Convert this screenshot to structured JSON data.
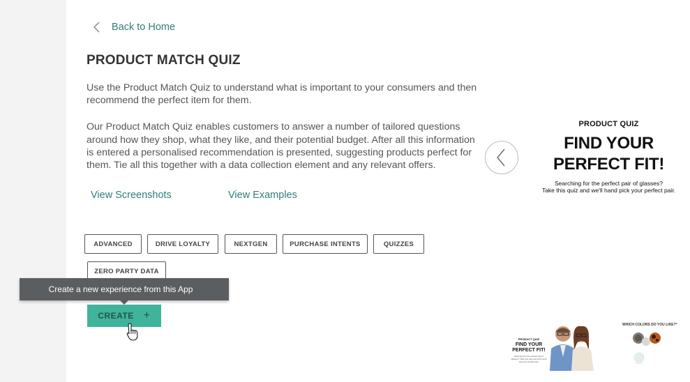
{
  "nav": {
    "back_label": "Back to Home"
  },
  "app": {
    "title": "PRODUCT MATCH QUIZ",
    "description": [
      "Use the Product Match Quiz to understand what is important to your consumers and then recommend the perfect item for them.",
      "Our Product Match Quiz enables customers to answer a number of tailored questions around how they shop, what they like, and their potential budget. After all this information is entered a personalised recommendation is presented, suggesting products perfect for them. Tie all this together with a data collection element and any relevant offers."
    ],
    "links": {
      "screenshots": "View Screenshots",
      "examples": "View Examples"
    },
    "tags": [
      "ADVANCED",
      "DRIVE LOYALTY",
      "NEXTGEN",
      "PURCHASE INTENTS",
      "QUIZZES",
      "ZERO PARTY DATA"
    ],
    "tooltip": "Create a new experience from this App",
    "create_label": "CREATE"
  },
  "preview": {
    "kicker": "PRODUCT QUIZ",
    "headline_1": "FIND YOUR",
    "headline_2": "PERFECT FIT!",
    "sub_1": "Searching for the perfect pair of glasses?",
    "sub_2": "Take this quiz and we'll hand pick your perfect pair.",
    "thumb1": {
      "kicker": "PRODUCT QUIZ",
      "headline": "FIND YOUR PERFECT FIT!",
      "sub": "Searching for the perfect pair of glasses? Take this quiz and we'll hand pick your perfect pair."
    },
    "thumb2": {
      "question": "WHICH COLORS DO YOU LIKE?*"
    }
  },
  "colors": {
    "accent": "#3fb49a",
    "link": "#2e7d7a",
    "tooltip_bg": "#5a5e60",
    "rail": "#f3f3f3"
  },
  "icons": {
    "back": "chevron-left-icon",
    "carousel_prev": "chevron-left-icon",
    "create": "plus-icon",
    "cursor": "hand-pointer-icon"
  }
}
